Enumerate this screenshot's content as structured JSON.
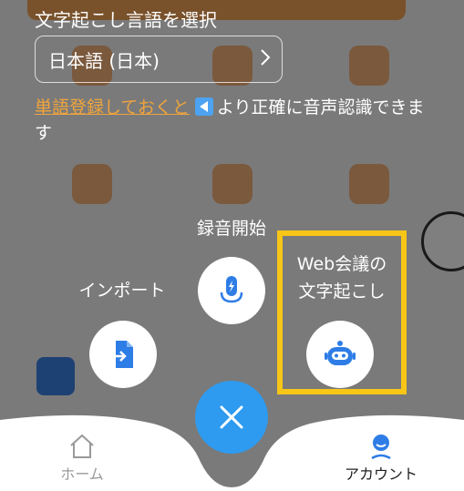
{
  "language": {
    "title": "文字起こし言語を選択",
    "selected": "日本語 (日本)"
  },
  "hint": {
    "link_text": "単語登録しておくと",
    "rest_text": "より正確に音声認識できます"
  },
  "actions": {
    "record": "録音開始",
    "import": "インポート",
    "web_meeting_line1": "Web会議の",
    "web_meeting_line2": "文字起こし"
  },
  "tabbar": {
    "home": "ホーム",
    "account": "アカウント"
  },
  "colors": {
    "accent": "#2e9bf0",
    "highlight": "#f7c617",
    "link": "#f0a43c"
  },
  "icons": [
    "chevron-right-icon",
    "speaker-icon",
    "mic-icon",
    "import-file-icon",
    "bot-icon",
    "close-icon",
    "home-icon",
    "account-icon"
  ]
}
